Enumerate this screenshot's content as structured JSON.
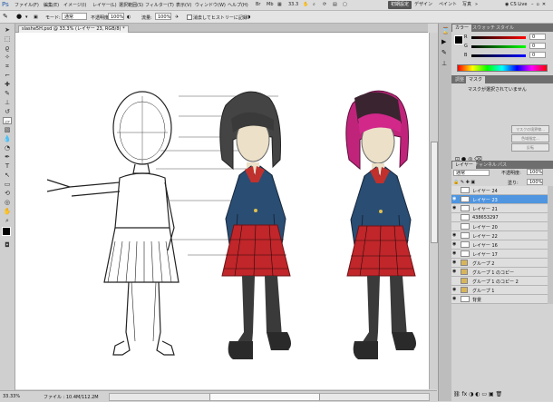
{
  "menu": {
    "items": [
      "ファイル(F)",
      "編集(E)",
      "イメージ(I)",
      "レイヤー(L)",
      "選択範囲(S)",
      "フィルター(T)",
      "表示(V)",
      "ウィンドウ(W)",
      "ヘルプ(H)"
    ],
    "zoom": "33.3",
    "workspaces": [
      "初期設定",
      "デザイン",
      "ペイント",
      "写真"
    ],
    "active_workspace": "初期設定",
    "cs_live": "CS Live"
  },
  "options": {
    "mode_label": "モード:",
    "mode_value": "通常",
    "opacity_label": "不透明度:",
    "opacity_value": "100%",
    "flow_label": "流量:",
    "flow_value": "100%",
    "airbrush_label": "消去してヒストリーに記録"
  },
  "document": {
    "tab_title": "slashe5H.psd @ 33.3% (レイヤー 23, RGB/8) *",
    "zoom_status": "33.33%",
    "file_status": "ファイル : 10.4M/112.2M"
  },
  "color_panel": {
    "tabs": [
      "カラー",
      "スウォッチ",
      "スタイル"
    ],
    "channels": [
      {
        "label": "R",
        "value": "0"
      },
      {
        "label": "G",
        "value": "0"
      },
      {
        "label": "B",
        "value": "0"
      }
    ]
  },
  "mask_panel": {
    "tabs": [
      "調整",
      "マスク"
    ],
    "message": "マスクが選択されていません",
    "buttons": [
      "マスクの境界線...",
      "色域指定...",
      "反転"
    ]
  },
  "layers_panel": {
    "tabs": [
      "レイヤー",
      "チャンネル",
      "パス"
    ],
    "blend_mode": "通常",
    "opacity_label": "不透明度:",
    "opacity_value": "100%",
    "fill_label": "塗り:",
    "fill_value": "100%",
    "layers": [
      {
        "name": "レイヤー 24",
        "visible": false,
        "selected": false,
        "group": false
      },
      {
        "name": "レイヤー 23",
        "visible": true,
        "selected": true,
        "group": false
      },
      {
        "name": "レイヤー 21",
        "visible": true,
        "selected": false,
        "group": false
      },
      {
        "name": "438653297",
        "visible": false,
        "selected": false,
        "group": false
      },
      {
        "name": "レイヤー 20",
        "visible": false,
        "selected": false,
        "group": false
      },
      {
        "name": "レイヤー 22",
        "visible": true,
        "selected": false,
        "group": false
      },
      {
        "name": "レイヤー 16",
        "visible": true,
        "selected": false,
        "group": false
      },
      {
        "name": "レイヤー 17",
        "visible": true,
        "selected": false,
        "group": false
      },
      {
        "name": "グループ 2",
        "visible": true,
        "selected": false,
        "group": true
      },
      {
        "name": "グループ 1 のコピー",
        "visible": true,
        "selected": false,
        "group": true
      },
      {
        "name": "グループ 1 のコピー 2",
        "visible": false,
        "selected": false,
        "group": true
      },
      {
        "name": "グループ 1",
        "visible": true,
        "selected": false,
        "group": true
      },
      {
        "name": "背景",
        "visible": true,
        "selected": false,
        "group": false
      }
    ]
  }
}
